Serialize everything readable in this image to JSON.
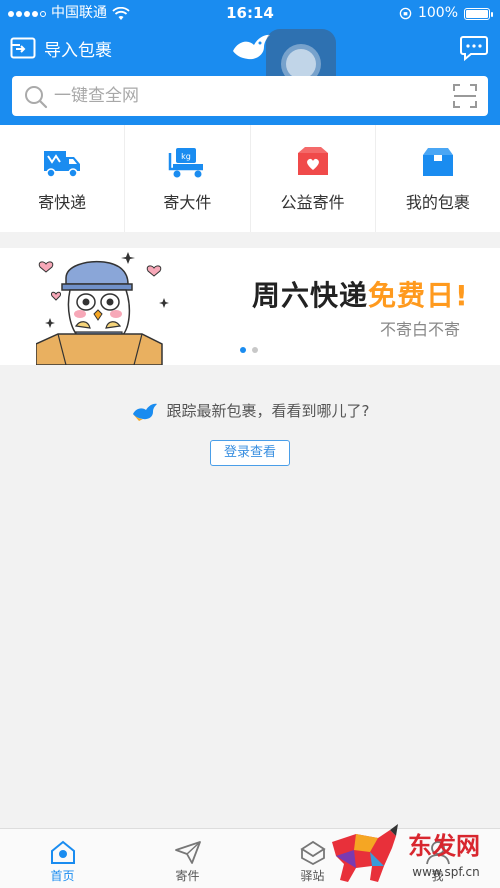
{
  "status": {
    "carrier": "中国联通",
    "time": "16:14",
    "battery": "100%"
  },
  "header": {
    "import_label": "导入包裹",
    "search_placeholder": "一键查全网"
  },
  "actions": [
    {
      "label": "寄快递",
      "icon": "truck-icon"
    },
    {
      "label": "寄大件",
      "icon": "large-parcel-icon"
    },
    {
      "label": "公益寄件",
      "icon": "charity-box-icon"
    },
    {
      "label": "我的包裹",
      "icon": "parcel-box-icon"
    }
  ],
  "banner": {
    "headline_main": "周六快递",
    "headline_highlight": "免费日!",
    "sub": "不寄白不寄",
    "page_count": 2,
    "active_page": 1
  },
  "track": {
    "message": "跟踪最新包裹，看看到哪儿了?",
    "login_label": "登录查看"
  },
  "tabs": [
    {
      "label": "首页",
      "icon": "home-icon",
      "active": true
    },
    {
      "label": "寄件",
      "icon": "paper-plane-icon",
      "active": false
    },
    {
      "label": "驿站",
      "icon": "station-icon",
      "active": false
    },
    {
      "label": "我",
      "icon": "profile-icon",
      "active": false
    }
  ],
  "watermark": {
    "text": "东发网",
    "url": "www.spf.cn"
  },
  "colors": {
    "primary": "#1a8cf0",
    "accent_orange": "#ff9a1e",
    "charity_red": "#f04a4a",
    "background": "#f2f2f2"
  }
}
